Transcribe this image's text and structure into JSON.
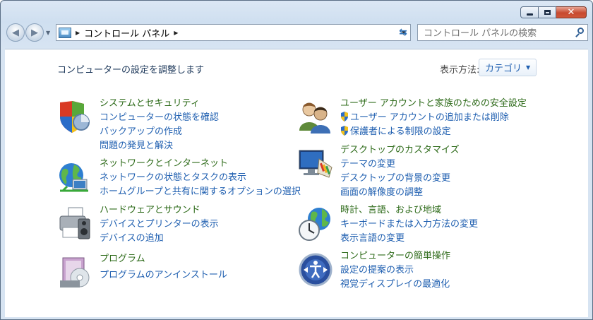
{
  "window": {
    "caption": {
      "close_glyph": "✕"
    }
  },
  "toolbar": {
    "back_glyph": "◀",
    "forward_glyph": "▶",
    "breadcrumb": "コントロール パネル",
    "refresh_glyph": "⇆",
    "search_placeholder": "コントロール パネルの検索"
  },
  "content": {
    "title": "コンピューターの設定を調整します",
    "view_label": "表示方法:",
    "view_value": "カテゴリ"
  },
  "categories": [
    {
      "name": "system",
      "icon": "shield-computer-icon",
      "heading": "システムとセキュリティ",
      "links": [
        "コンピューターの状態を確認",
        "バックアップの作成",
        "問題の発見と解決"
      ]
    },
    {
      "name": "network",
      "icon": "network-globe-icon",
      "heading": "ネットワークとインターネット",
      "links": [
        "ネットワークの状態とタスクの表示",
        "ホームグループと共有に関するオプションの選択"
      ]
    },
    {
      "name": "hardware",
      "icon": "printer-icon",
      "heading": "ハードウェアとサウンド",
      "links": [
        "デバイスとプリンターの表示",
        "デバイスの追加"
      ]
    },
    {
      "name": "programs",
      "icon": "programs-icon",
      "heading": "プログラム",
      "links": [
        "プログラムのアンインストール"
      ]
    },
    {
      "name": "user-accounts",
      "icon": "users-icon",
      "heading": "ユーザー アカウントと家族のための安全設定",
      "links": [
        "ユーザー アカウントの追加または削除",
        "保護者による制限の設定"
      ]
    },
    {
      "name": "appearance",
      "icon": "desktop-icon",
      "heading": "デスクトップのカスタマイズ",
      "links": [
        "テーマの変更",
        "デスクトップの背景の変更",
        "画面の解像度の調整"
      ]
    },
    {
      "name": "clock-region",
      "icon": "clock-globe-icon",
      "heading": "時計、言語、および地域",
      "links": [
        "キーボードまたは入力方法の変更",
        "表示言語の変更"
      ]
    },
    {
      "name": "ease-of-access",
      "icon": "ease-of-access-icon",
      "heading": "コンピューターの簡単操作",
      "links": [
        "設定の提案の表示",
        "視覚ディスプレイの最適化"
      ]
    }
  ]
}
